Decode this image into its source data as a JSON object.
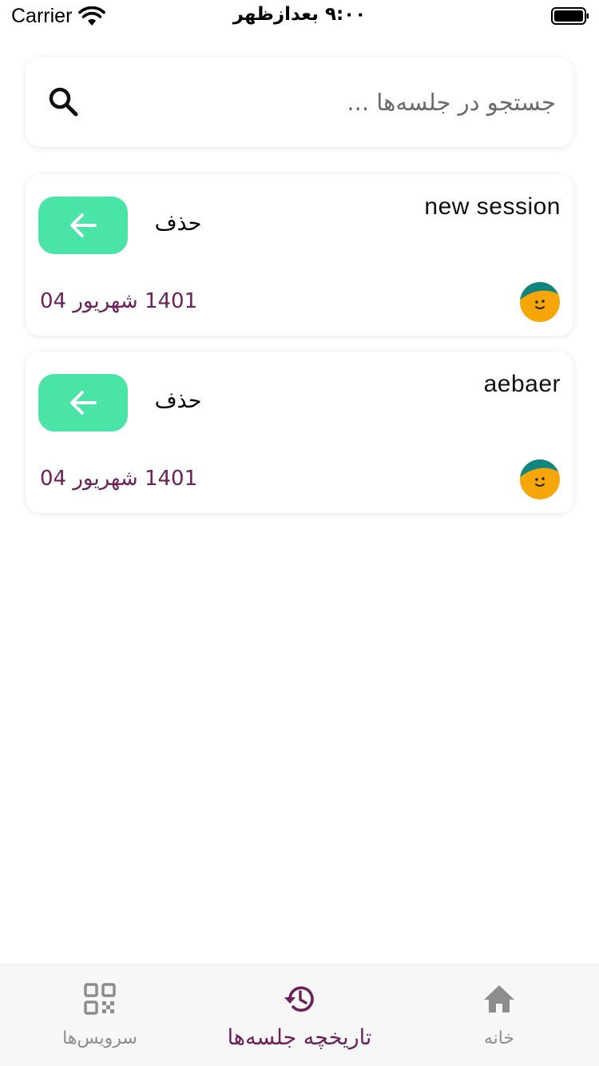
{
  "status_bar": {
    "carrier": "Carrier",
    "time": "۹:۰۰ بعدازظهر"
  },
  "search": {
    "placeholder": "جستجو در جلسه‌ها ..."
  },
  "sessions": [
    {
      "title": "new session",
      "delete_label": "حذف",
      "date": "1401 شهریور 04",
      "avatar_icon": "user-avatar-icon"
    },
    {
      "title": "aebaer",
      "delete_label": "حذف",
      "date": "1401 شهریور 04",
      "avatar_icon": "user-avatar-icon"
    }
  ],
  "bottom_nav": {
    "services_label": "سرویس‌ها",
    "history_label": "تاریخچه جلسه‌ها",
    "home_label": "خانه",
    "active": "history"
  },
  "colors": {
    "accent": "#6b2158",
    "button_green": "#4ae3a8",
    "inactive": "#8d8d8d"
  }
}
